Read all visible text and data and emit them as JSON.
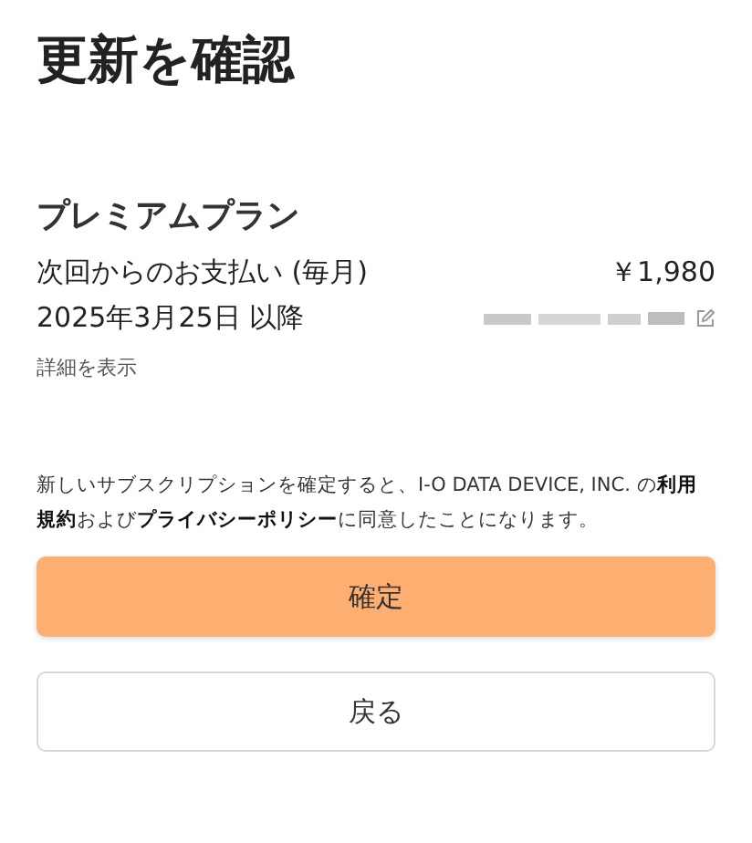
{
  "title": "更新を確認",
  "plan": {
    "name": "プレミアムプラン",
    "payment_label": "次回からのお支払い (毎月)",
    "price": "￥1,980",
    "start_date": "2025年3月25日 以降",
    "details_link": "詳細を表示"
  },
  "terms": {
    "text": "新しいサブスクリプションを確定すると、I-O DATA DEVICE, INC. の**利用規約**および**プライバシーポリシー**に同意したことになります。"
  },
  "buttons": [
    {
      "label": "確定",
      "kind": "primary"
    },
    {
      "label": "戻る",
      "kind": "secondary"
    }
  ]
}
